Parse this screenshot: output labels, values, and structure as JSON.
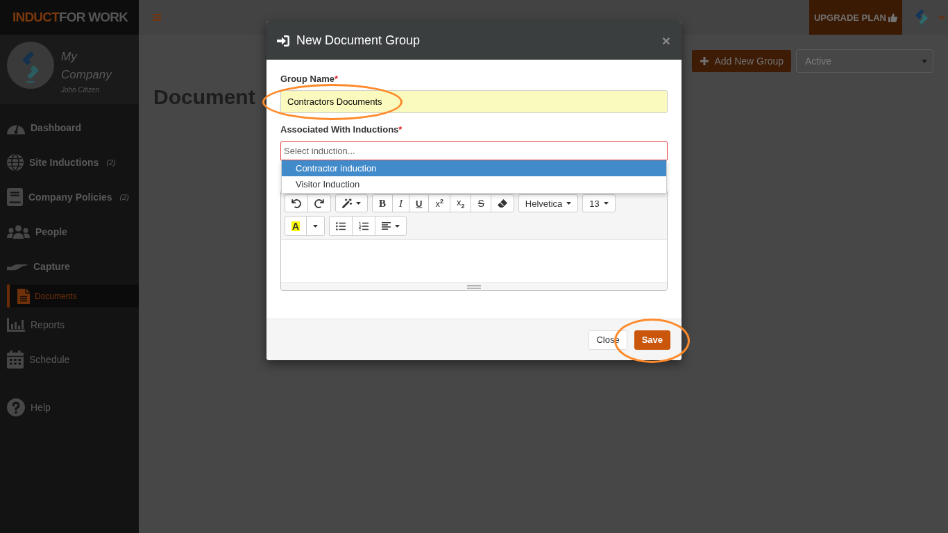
{
  "sidebar": {
    "logo": {
      "accent": "INDUCT",
      "rest": "FOR WORK"
    },
    "profile": {
      "company": "My Company",
      "user": "John Citizen"
    },
    "items": [
      {
        "label": "Dashboard",
        "kind": "heading",
        "selected": false
      },
      {
        "label": "Site Inductions",
        "count": "(2)",
        "kind": "heading",
        "selected": false
      },
      {
        "label": "Company Policies",
        "count": "(2)",
        "kind": "heading",
        "selected": false
      },
      {
        "label": "People",
        "kind": "heading",
        "selected": false
      },
      {
        "label": "Capture",
        "kind": "heading",
        "selected": false,
        "children": [
          {
            "label": "Documents",
            "kind": "link",
            "selected": true
          }
        ]
      },
      {
        "label": "Reports",
        "kind": "link",
        "selected": false
      },
      {
        "label": "Schedule",
        "kind": "link",
        "selected": false
      }
    ],
    "help": {
      "label": "Help"
    }
  },
  "top_bar": {
    "upgrade_button": {
      "label": "UPGRADE PLAN"
    }
  },
  "page": {
    "title": "Document",
    "add_button": {
      "label": "Add New Group"
    },
    "status_filter": {
      "value": "Active"
    }
  },
  "dialog": {
    "title": "New Document Group",
    "close": "×",
    "fields": [
      {
        "kind": "text",
        "label": "Group Name",
        "required_mark": "*",
        "value": "Contractors Documents",
        "highlighted": true
      },
      {
        "kind": "select",
        "label": "Associated With Inductions",
        "required_mark": "*",
        "placeholder": "Select induction...",
        "invalid": true,
        "expanded": true,
        "highlighted": false,
        "options": [
          {
            "label": "Contractor induction",
            "selected": true
          },
          {
            "label": "Visitor Induction",
            "selected": false
          }
        ]
      }
    ],
    "editor": {
      "toolbar_rows": [
        [
          [
            {
              "kind": "icon"
            },
            {
              "kind": "icon"
            }
          ],
          [
            {
              "kind": "icon",
              "dropdown": true
            }
          ],
          [
            {
              "kind": "bold",
              "label": "B"
            },
            {
              "kind": "italic",
              "label": "I"
            },
            {
              "kind": "underline",
              "label": "U"
            },
            {
              "kind": "text",
              "label": "x$^{2}$"
            },
            {
              "kind": "text",
              "label": "x$_{2}$"
            },
            {
              "kind": "strike",
              "label": "S"
            },
            {
              "kind": "icon"
            }
          ],
          [
            {
              "kind": "text",
              "label": "Helvetica",
              "dropdown": true
            }
          ],
          [
            {
              "kind": "text",
              "label": "13",
              "dropdown": true
            }
          ]
        ],
        [
          [
            {
              "kind": "highlight",
              "label": "A"
            },
            {
              "kind": "icon"
            }
          ],
          [
            {
              "kind": "icon"
            },
            {
              "kind": "icon"
            },
            {
              "kind": "icon",
              "dropdown": true
            }
          ]
        ]
      ]
    },
    "buttons": [
      {
        "label": "Close",
        "kind": "secondary",
        "highlighted": false
      },
      {
        "label": "Save",
        "kind": "primary",
        "highlighted": true
      }
    ]
  }
}
